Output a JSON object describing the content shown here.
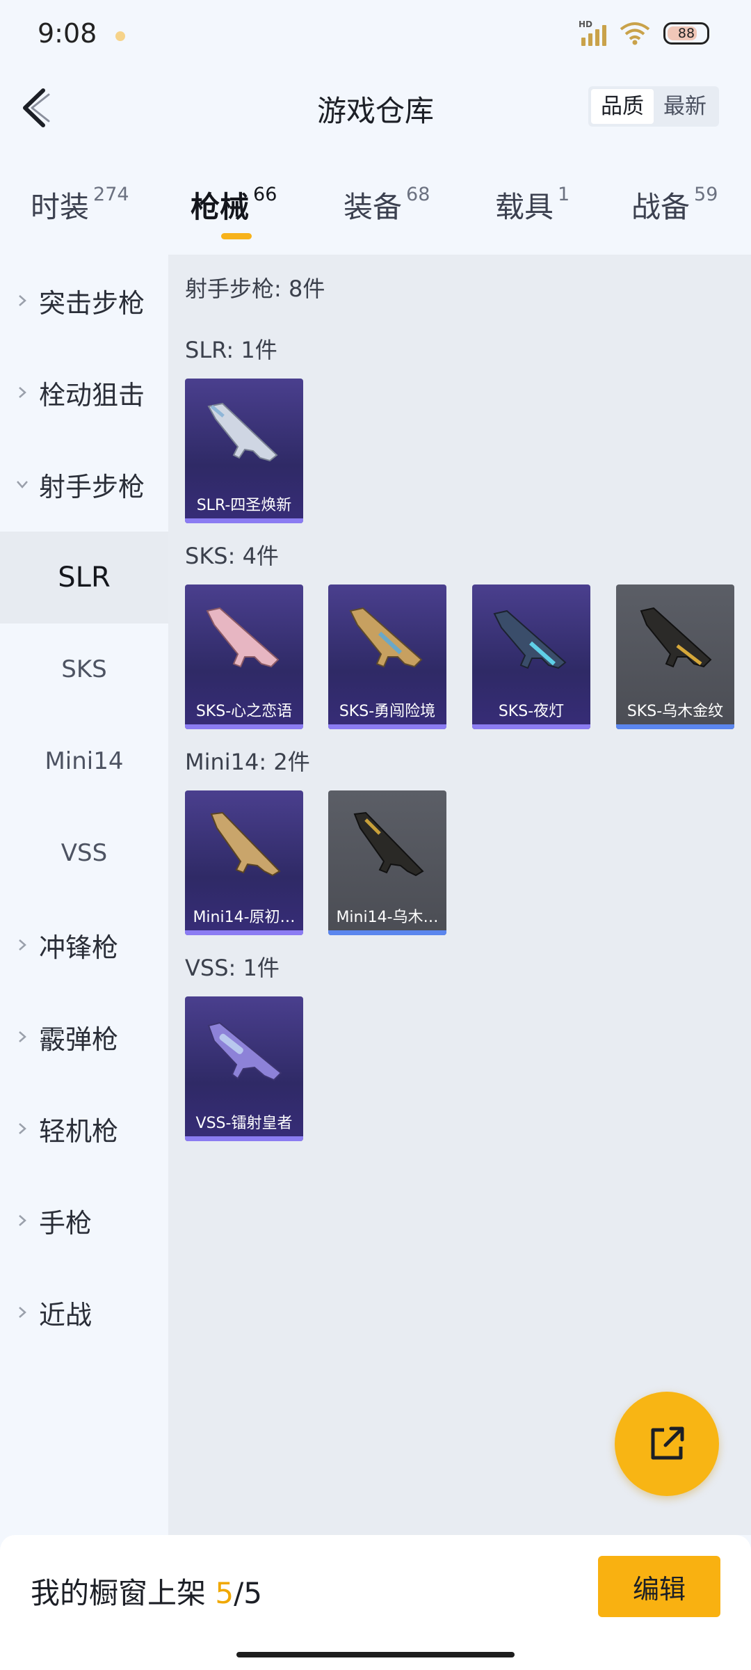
{
  "status": {
    "time": "9:08",
    "battery": "88"
  },
  "header": {
    "title": "游戏仓库",
    "sort_options": [
      "品质",
      "最新"
    ],
    "active_sort": "品质"
  },
  "tabs": [
    {
      "label": "时装",
      "count": "274"
    },
    {
      "label": "枪械",
      "count": "66"
    },
    {
      "label": "装备",
      "count": "68"
    },
    {
      "label": "载具",
      "count": "1"
    },
    {
      "label": "战备",
      "count": "59"
    }
  ],
  "sidebar": {
    "items": [
      {
        "label": "突击步枪"
      },
      {
        "label": "栓动狙击"
      },
      {
        "label": "射手步枪"
      },
      {
        "label": "SLR"
      },
      {
        "label": "SKS"
      },
      {
        "label": "Mini14"
      },
      {
        "label": "VSS"
      },
      {
        "label": "冲锋枪"
      },
      {
        "label": "霰弹枪"
      },
      {
        "label": "轻机枪"
      },
      {
        "label": "手枪"
      },
      {
        "label": "近战"
      }
    ]
  },
  "content": {
    "category_title": "射手步枪: 8件",
    "groups": [
      {
        "title": "SLR: 1件",
        "items": [
          {
            "name": "SLR-四圣焕新"
          }
        ]
      },
      {
        "title": "SKS: 4件",
        "items": [
          {
            "name": "SKS-心之恋语"
          },
          {
            "name": "SKS-勇闯险境"
          },
          {
            "name": "SKS-夜灯"
          },
          {
            "name": "SKS-乌木金纹"
          }
        ]
      },
      {
        "title": "Mini14: 2件",
        "items": [
          {
            "name": "Mini14-原初…"
          },
          {
            "name": "Mini14-乌木…"
          }
        ]
      },
      {
        "title": "VSS: 1件",
        "items": [
          {
            "name": "VSS-镭射皇者"
          }
        ]
      }
    ]
  },
  "bottom": {
    "label": "我的橱窗上架",
    "count": "5",
    "total": "/5",
    "edit_label": "编辑"
  },
  "colors": {
    "accent": "#f8b514",
    "card_purple": "#3a3278",
    "card_gray": "#55575e"
  }
}
